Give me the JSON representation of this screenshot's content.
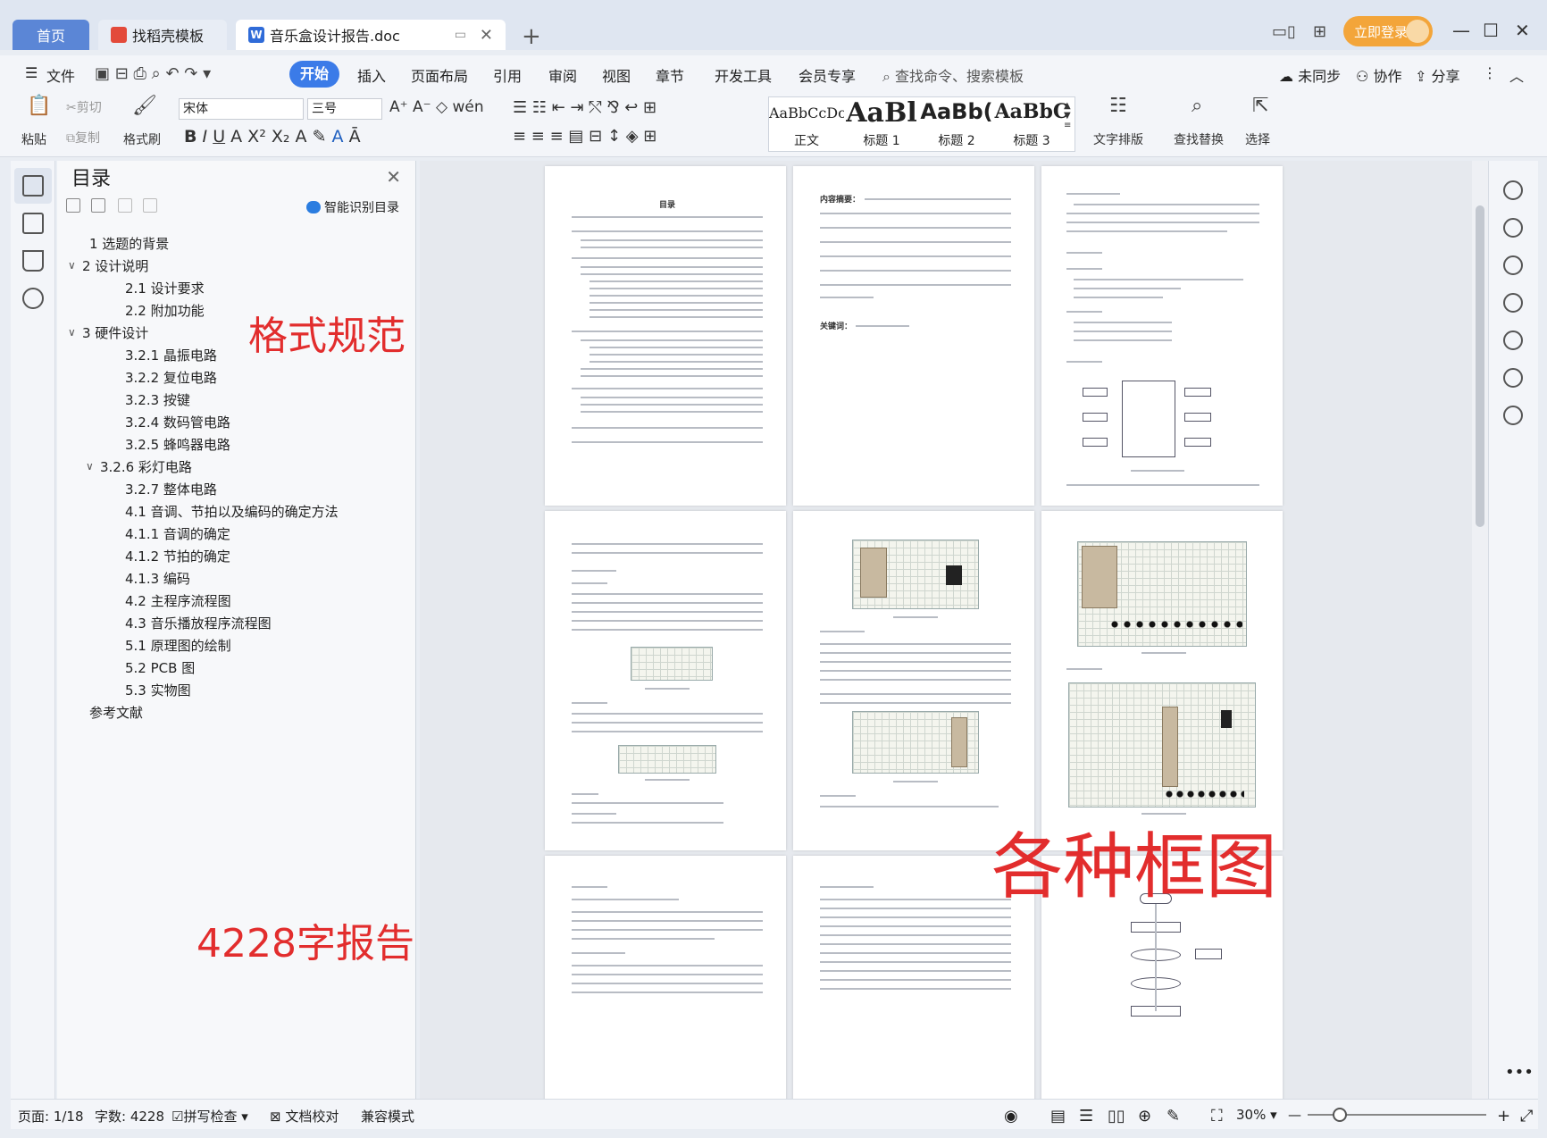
{
  "titlebar": {
    "tabs": [
      {
        "label": "首页"
      },
      {
        "label": "找稻壳模板"
      },
      {
        "label": "音乐盒设计报告.doc"
      }
    ],
    "login_label": "立即登录"
  },
  "menu": {
    "file": "文件",
    "items": [
      "开始",
      "插入",
      "页面布局",
      "引用",
      "审阅",
      "视图",
      "章节",
      "开发工具",
      "会员专享"
    ],
    "search": "查找命令、搜索模板",
    "sync": "未同步",
    "collab": "协作",
    "share": "分享"
  },
  "ribbon": {
    "paste": "粘贴",
    "cut": "剪切",
    "copy": "复制",
    "format_painter": "格式刷",
    "font_name": "宋体",
    "font_size": "三号",
    "styles": [
      {
        "sample": "AaBbCcDc",
        "label": "正文"
      },
      {
        "sample": "AaBl",
        "label": "标题 1"
      },
      {
        "sample": "AaBb(",
        "label": "标题 2"
      },
      {
        "sample": "AaBbC",
        "label": "标题 3"
      }
    ],
    "text_layout": "文字排版",
    "find_replace": "查找替换",
    "select": "选择"
  },
  "toc": {
    "title": "目录",
    "smart": "智能识别目录",
    "items": [
      {
        "text": "1  选题的背景"
      },
      {
        "text": "2  设计说明"
      },
      {
        "text": "2.1  设计要求"
      },
      {
        "text": "2.2  附加功能"
      },
      {
        "text": "3    硬件设计"
      },
      {
        "text": "3.2.1  晶振电路"
      },
      {
        "text": "3.2.2  复位电路"
      },
      {
        "text": "3.2.3  按键"
      },
      {
        "text": "3.2.4  数码管电路"
      },
      {
        "text": "3.2.5  蜂鸣器电路"
      },
      {
        "text": "3.2.6  彩灯电路"
      },
      {
        "text": "3.2.7  整体电路"
      },
      {
        "text": "4.1  音调、节拍以及编码的确定方法"
      },
      {
        "text": "4.1.1    音调的确定"
      },
      {
        "text": "4.1.2    节拍的确定"
      },
      {
        "text": "4.1.3    编码"
      },
      {
        "text": "4.2    主程序流程图"
      },
      {
        "text": "4.3  音乐播放程序流程图"
      },
      {
        "text": "5.1  原理图的绘制"
      },
      {
        "text": "5.2  PCB 图"
      },
      {
        "text": "5.3  实物图"
      },
      {
        "text": "参考文献"
      }
    ]
  },
  "overlays": {
    "format": "格式规范",
    "words": "4228字报告",
    "diagrams": "各种框图"
  },
  "pages": {
    "toc_title": "目录",
    "abstract_label": "内容摘要：",
    "keywords_label": "关键词："
  },
  "statusbar": {
    "page": "页面: 1/18",
    "words": "字数: 4228",
    "spell": "拼写检查",
    "proof": "文档校对",
    "compat": "兼容模式",
    "zoom": "30%"
  }
}
